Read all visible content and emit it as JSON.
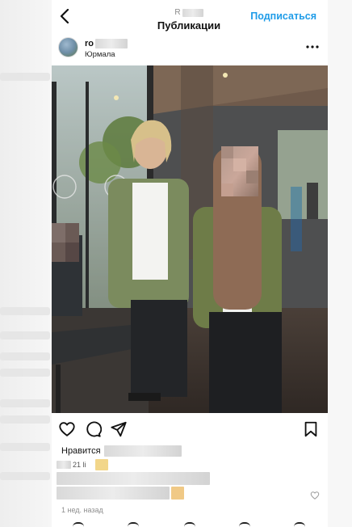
{
  "header": {
    "username_partial": "R",
    "title": "Публикации",
    "subscribe_label": "Подписаться"
  },
  "post": {
    "author_partial": "ro",
    "location": "Юрмала",
    "likes_label": "Нравится",
    "caption_partial": "21 li",
    "time_ago": "1 нед. назад"
  },
  "icons": {
    "back": "chevron-left-icon",
    "more": "more-horizontal-icon",
    "like": "heart-icon",
    "comment": "comment-icon",
    "share": "send-icon",
    "save": "bookmark-icon"
  },
  "colors": {
    "accent": "#1f9ce8",
    "text": "#111111",
    "muted": "#8e8e8e"
  }
}
